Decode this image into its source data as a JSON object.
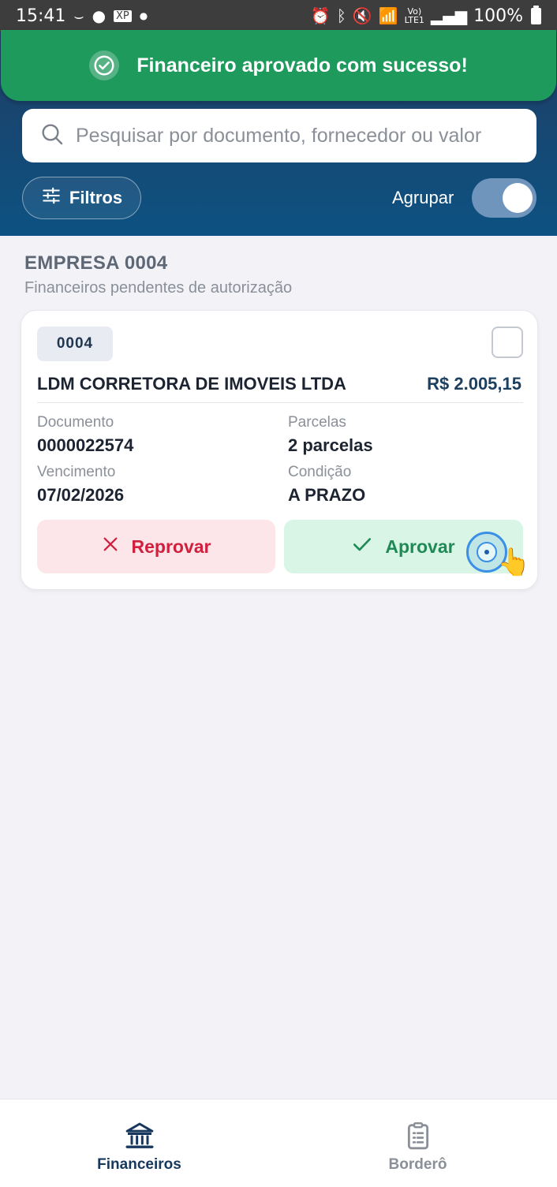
{
  "status_bar": {
    "time": "15:41",
    "battery": "100%",
    "left_icons": [
      "amazon-icon",
      "chat-icon",
      "xp-app-icon"
    ],
    "right_icons": [
      "alarm-icon",
      "bluetooth-icon",
      "mute-icon",
      "wifi-icon",
      "volte-lte-icon",
      "signal-icon",
      "battery-icon"
    ]
  },
  "toast": {
    "message": "Financeiro aprovado com sucesso!",
    "color": "#1f9a5d"
  },
  "search": {
    "placeholder": "Pesquisar por documento, fornecedor ou valor"
  },
  "filters": {
    "label": "Filtros"
  },
  "group_toggle": {
    "label": "Agrupar",
    "on": true
  },
  "group": {
    "title": "EMPRESA 0004",
    "subtitle": "Financeiros pendentes de autorização"
  },
  "card": {
    "badge": "0004",
    "supplier": "LDM CORRETORA DE IMOVEIS LTDA",
    "amount": "R$ 2.005,15",
    "fields": {
      "documento_label": "Documento",
      "documento_value": "0000022574",
      "parcelas_label": "Parcelas",
      "parcelas_value": "2 parcelas",
      "vencimento_label": "Vencimento",
      "vencimento_value": "07/02/2026",
      "condicao_label": "Condição",
      "condicao_value": "A PRAZO"
    },
    "reject_label": "Reprovar",
    "approve_label": "Aprovar"
  },
  "bottom_nav": {
    "items": [
      {
        "label": "Financeiros",
        "icon": "bank-icon",
        "active": true
      },
      {
        "label": "Borderô",
        "icon": "clipboard-list-icon",
        "active": false
      }
    ]
  },
  "colors": {
    "header_top": "#1f3d63",
    "header_bottom": "#0d5282",
    "reject": "#d0203d",
    "approve": "#1f8a55",
    "nav_active": "#17385c"
  }
}
